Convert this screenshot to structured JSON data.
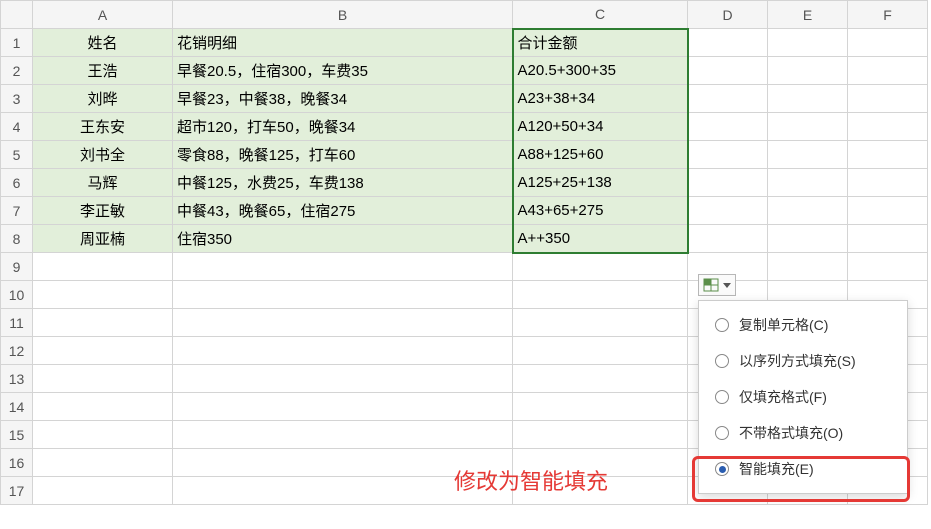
{
  "columns": [
    "A",
    "B",
    "C",
    "D",
    "E",
    "F"
  ],
  "row_numbers": [
    "1",
    "2",
    "3",
    "4",
    "5",
    "6",
    "7",
    "8",
    "9",
    "10",
    "11",
    "12",
    "13",
    "14",
    "15",
    "16",
    "17"
  ],
  "header_row": {
    "A": "姓名",
    "B": "花销明细",
    "C": "合计金额"
  },
  "data_rows": [
    {
      "A": "王浩",
      "B": "早餐20.5，住宿300，车费35",
      "C": "A20.5+300+35"
    },
    {
      "A": "刘晔",
      "B": "早餐23，中餐38，晚餐34",
      "C": "A23+38+34"
    },
    {
      "A": "王东安",
      "B": "超市120，打车50，晚餐34",
      "C": "A120+50+34"
    },
    {
      "A": "刘书全",
      "B": "零食88，晚餐125，打车60",
      "C": "A88+125+60"
    },
    {
      "A": "马辉",
      "B": "中餐125，水费25，车费138",
      "C": "A125+25+138"
    },
    {
      "A": "李正敏",
      "B": "中餐43，晚餐65，住宿275",
      "C": "A43+65+275"
    },
    {
      "A": "周亚楠",
      "B": "住宿350",
      "C": "A++350"
    }
  ],
  "fill_menu": {
    "items": [
      {
        "label": "复制单元格(C)",
        "checked": false
      },
      {
        "label": "以序列方式填充(S)",
        "checked": false
      },
      {
        "label": "仅填充格式(F)",
        "checked": false
      },
      {
        "label": "不带格式填充(O)",
        "checked": false
      },
      {
        "label": "智能填充(E)",
        "checked": true
      }
    ]
  },
  "annotation": "修改为智能填充"
}
